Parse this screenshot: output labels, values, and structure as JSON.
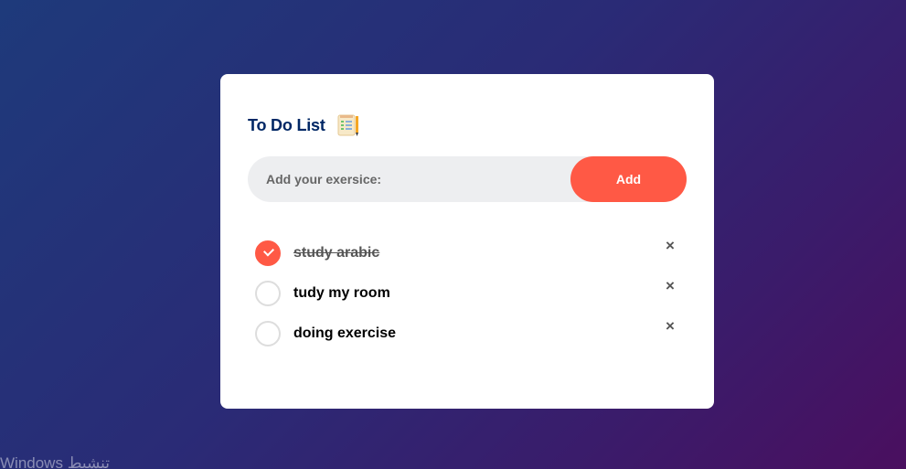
{
  "app": {
    "title": "To Do List",
    "icon": "notepad-checklist-icon"
  },
  "input": {
    "placeholder": "Add your exersice:",
    "value": ""
  },
  "add_button": {
    "label": "Add"
  },
  "tasks": [
    {
      "label": "study arabic",
      "done": true,
      "remove_label": "×"
    },
    {
      "label": "tudy my room",
      "done": false,
      "remove_label": "×"
    },
    {
      "label": "doing exercise",
      "done": false,
      "remove_label": "×"
    }
  ],
  "colors": {
    "accent": "#ff5945",
    "title": "#002765",
    "input_bg": "#edeef0",
    "card_bg": "#ffffff"
  },
  "watermark": {
    "text": "Windows تنشيط"
  }
}
